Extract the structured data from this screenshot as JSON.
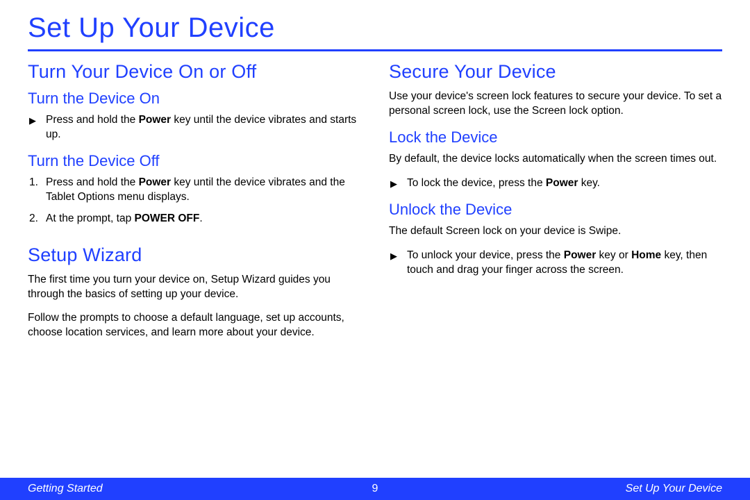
{
  "title": "Set Up Your Device",
  "left": {
    "h1": "Turn Your Device On or Off",
    "on": {
      "heading": "Turn the Device On",
      "bullet_pre": "Press and hold the ",
      "bullet_bold": "Power",
      "bullet_post": " key until the device vibrates and starts up."
    },
    "off": {
      "heading": "Turn the Device Off",
      "step1_pre": "Press and hold the ",
      "step1_bold": "Power",
      "step1_post": " key until the device vibrates and the Tablet Options menu displays.",
      "step2_pre": "At the prompt, tap ",
      "step2_bold": "POWER OFF",
      "step2_post": "."
    },
    "wizard": {
      "heading": "Setup Wizard",
      "p1": "The first time you turn your device on, Setup Wizard guides you through the basics of setting up your device.",
      "p2": "Follow the prompts to choose a default language, set up accounts, choose location services, and learn more about your device."
    }
  },
  "right": {
    "h1": "Secure Your Device",
    "intro": "Use your device's screen lock features to secure your device. To set a personal screen lock, use the Screen lock option.",
    "lock": {
      "heading": "Lock the Device",
      "p": "By default, the device locks automatically when the screen times out.",
      "bullet_pre": "To lock the device, press the ",
      "bullet_bold": "Power",
      "bullet_post": " key."
    },
    "unlock": {
      "heading": "Unlock the Device",
      "p": "The default Screen lock on your device is Swipe.",
      "bullet_pre": "To unlock your device, press the ",
      "bullet_bold1": "Power",
      "bullet_mid": " key or ",
      "bullet_bold2": "Home",
      "bullet_post": " key, then touch and drag your finger across the screen."
    }
  },
  "footer": {
    "left": "Getting Started",
    "page": "9",
    "right": "Set Up Your Device"
  }
}
